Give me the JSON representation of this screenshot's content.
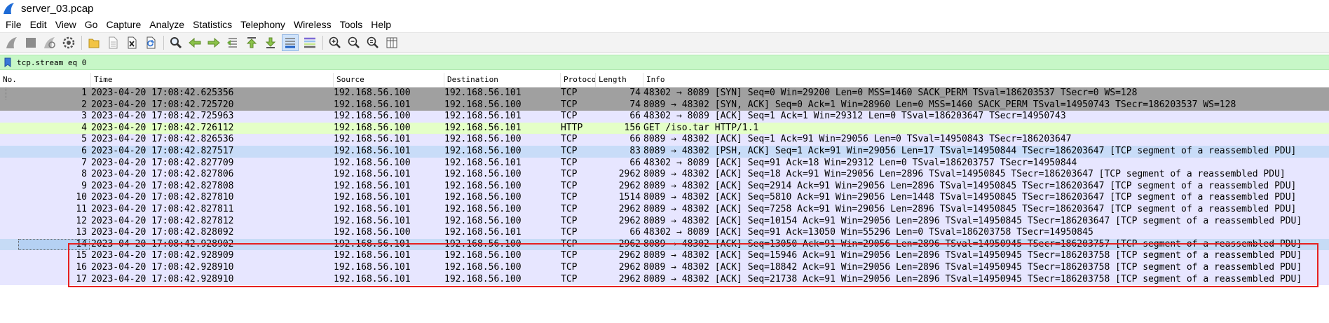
{
  "window": {
    "title": "server_03.pcap"
  },
  "menu": [
    "File",
    "Edit",
    "View",
    "Go",
    "Capture",
    "Analyze",
    "Statistics",
    "Telephony",
    "Wireless",
    "Tools",
    "Help"
  ],
  "toolbar_icons": [
    "shark-fin-start-icon",
    "stop-square-icon",
    "restart-fin-icon",
    "capture-options-gear-icon",
    "open-folder-icon",
    "file-document-icon",
    "close-file-x-icon",
    "reload-icon",
    "find-magnifier-icon",
    "back-arrow-icon",
    "forward-arrow-icon",
    "go-to-packet-icon",
    "first-packet-icon",
    "last-packet-icon",
    "auto-scroll-icon",
    "colorize-icon",
    "zoom-in-icon",
    "zoom-out-icon",
    "normal-size-icon",
    "resize-columns-icon"
  ],
  "filter": {
    "value": "tcp.stream eq 0"
  },
  "columns": {
    "no": "No.",
    "time": "Time",
    "source": "Source",
    "destination": "Destination",
    "protocol": "Protoco",
    "length": "Length",
    "info": "Info"
  },
  "colors": {
    "filter_bg": "#c7f7c7",
    "annotation": "#e62020",
    "tcp_gray": "#a0a0a0",
    "tcp_lavender": "#e7e6ff",
    "tcp_blue": "#c8dcf8",
    "http_green": "#e4ffc7"
  },
  "packets": [
    {
      "no": "1",
      "time": "2023-04-20 17:08:42.625356",
      "src": "192.168.56.100",
      "dst": "192.168.56.101",
      "proto": "TCP",
      "len": "74",
      "info": "48302 → 8089 [SYN] Seq=0 Win=29200 Len=0 MSS=1460 SACK_PERM TSval=186203537 TSecr=0 WS=128",
      "style": "tcp-gray"
    },
    {
      "no": "2",
      "time": "2023-04-20 17:08:42.725720",
      "src": "192.168.56.101",
      "dst": "192.168.56.100",
      "proto": "TCP",
      "len": "74",
      "info": "8089 → 48302 [SYN, ACK] Seq=0 Ack=1 Win=28960 Len=0 MSS=1460 SACK_PERM TSval=14950743 TSecr=186203537 WS=128",
      "style": "tcp-gray"
    },
    {
      "no": "3",
      "time": "2023-04-20 17:08:42.725963",
      "src": "192.168.56.100",
      "dst": "192.168.56.101",
      "proto": "TCP",
      "len": "66",
      "info": "48302 → 8089 [ACK] Seq=1 Ack=1 Win=29312 Len=0 TSval=186203647 TSecr=14950743",
      "style": "tcp-lav"
    },
    {
      "no": "4",
      "time": "2023-04-20 17:08:42.726112",
      "src": "192.168.56.100",
      "dst": "192.168.56.101",
      "proto": "HTTP",
      "len": "156",
      "info": "GET /iso.tar HTTP/1.1",
      "style": "http-green"
    },
    {
      "no": "5",
      "time": "2023-04-20 17:08:42.826536",
      "src": "192.168.56.101",
      "dst": "192.168.56.100",
      "proto": "TCP",
      "len": "66",
      "info": "8089 → 48302 [ACK] Seq=1 Ack=91 Win=29056 Len=0 TSval=14950843 TSecr=186203647",
      "style": "tcp-lav"
    },
    {
      "no": "6",
      "time": "2023-04-20 17:08:42.827517",
      "src": "192.168.56.101",
      "dst": "192.168.56.100",
      "proto": "TCP",
      "len": "83",
      "info": "8089 → 48302 [PSH, ACK] Seq=1 Ack=91 Win=29056 Len=17 TSval=14950844 TSecr=186203647 [TCP segment of a reassembled PDU]",
      "style": "tcp-blue"
    },
    {
      "no": "7",
      "time": "2023-04-20 17:08:42.827709",
      "src": "192.168.56.100",
      "dst": "192.168.56.101",
      "proto": "TCP",
      "len": "66",
      "info": "48302 → 8089 [ACK] Seq=91 Ack=18 Win=29312 Len=0 TSval=186203757 TSecr=14950844",
      "style": "tcp-lav"
    },
    {
      "no": "8",
      "time": "2023-04-20 17:08:42.827806",
      "src": "192.168.56.101",
      "dst": "192.168.56.100",
      "proto": "TCP",
      "len": "2962",
      "info": "8089 → 48302 [ACK] Seq=18 Ack=91 Win=29056 Len=2896 TSval=14950845 TSecr=186203647 [TCP segment of a reassembled PDU]",
      "style": "tcp-lav"
    },
    {
      "no": "9",
      "time": "2023-04-20 17:08:42.827808",
      "src": "192.168.56.101",
      "dst": "192.168.56.100",
      "proto": "TCP",
      "len": "2962",
      "info": "8089 → 48302 [ACK] Seq=2914 Ack=91 Win=29056 Len=2896 TSval=14950845 TSecr=186203647 [TCP segment of a reassembled PDU]",
      "style": "tcp-lav"
    },
    {
      "no": "10",
      "time": "2023-04-20 17:08:42.827810",
      "src": "192.168.56.101",
      "dst": "192.168.56.100",
      "proto": "TCP",
      "len": "1514",
      "info": "8089 → 48302 [ACK] Seq=5810 Ack=91 Win=29056 Len=1448 TSval=14950845 TSecr=186203647 [TCP segment of a reassembled PDU]",
      "style": "tcp-lav"
    },
    {
      "no": "11",
      "time": "2023-04-20 17:08:42.827811",
      "src": "192.168.56.101",
      "dst": "192.168.56.100",
      "proto": "TCP",
      "len": "2962",
      "info": "8089 → 48302 [ACK] Seq=7258 Ack=91 Win=29056 Len=2896 TSval=14950845 TSecr=186203647 [TCP segment of a reassembled PDU]",
      "style": "tcp-lav"
    },
    {
      "no": "12",
      "time": "2023-04-20 17:08:42.827812",
      "src": "192.168.56.101",
      "dst": "192.168.56.100",
      "proto": "TCP",
      "len": "2962",
      "info": "8089 → 48302 [ACK] Seq=10154 Ack=91 Win=29056 Len=2896 TSval=14950845 TSecr=186203647 [TCP segment of a reassembled PDU]",
      "style": "tcp-lav"
    },
    {
      "no": "13",
      "time": "2023-04-20 17:08:42.828092",
      "src": "192.168.56.100",
      "dst": "192.168.56.101",
      "proto": "TCP",
      "len": "66",
      "info": "48302 → 8089 [ACK] Seq=91 Ack=13050 Win=55296 Len=0 TSval=186203758 TSecr=14950845",
      "style": "tcp-lav"
    },
    {
      "no": "14",
      "time": "2023-04-20 17:08:42.928902",
      "src": "192.168.56.101",
      "dst": "192.168.56.100",
      "proto": "TCP",
      "len": "2962",
      "info": "8089 → 48302 [ACK] Seq=13050 Ack=91 Win=29056 Len=2896 TSval=14950945 TSecr=186203757 [TCP segment of a reassembled PDU]",
      "style": "selected"
    },
    {
      "no": "15",
      "time": "2023-04-20 17:08:42.928909",
      "src": "192.168.56.101",
      "dst": "192.168.56.100",
      "proto": "TCP",
      "len": "2962",
      "info": "8089 → 48302 [ACK] Seq=15946 Ack=91 Win=29056 Len=2896 TSval=14950945 TSecr=186203758 [TCP segment of a reassembled PDU]",
      "style": "tcp-lav"
    },
    {
      "no": "16",
      "time": "2023-04-20 17:08:42.928910",
      "src": "192.168.56.101",
      "dst": "192.168.56.100",
      "proto": "TCP",
      "len": "2962",
      "info": "8089 → 48302 [ACK] Seq=18842 Ack=91 Win=29056 Len=2896 TSval=14950945 TSecr=186203758 [TCP segment of a reassembled PDU]",
      "style": "tcp-lav"
    },
    {
      "no": "17",
      "time": "2023-04-20 17:08:42.928910",
      "src": "192.168.56.101",
      "dst": "192.168.56.100",
      "proto": "TCP",
      "len": "2962",
      "info": "8089 → 48302 [ACK] Seq=21738 Ack=91 Win=29056 Len=2896 TSval=14950945 TSecr=186203758 [TCP segment of a reassembled PDU]",
      "style": "tcp-lav"
    }
  ]
}
